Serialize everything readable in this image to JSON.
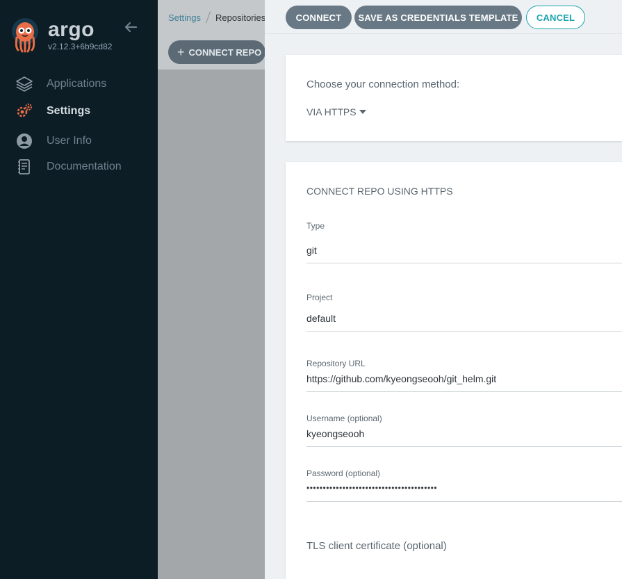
{
  "sidebar": {
    "brand": "argo",
    "version": "v2.12.3+6b9cd82",
    "items": [
      {
        "label": "Applications",
        "icon": "layers-icon",
        "active": false
      },
      {
        "label": "Settings",
        "icon": "gear-icon",
        "active": true
      },
      {
        "label": "User Info",
        "icon": "user-icon",
        "active": false
      },
      {
        "label": "Documentation",
        "icon": "book-icon",
        "active": false
      }
    ]
  },
  "background_page": {
    "breadcrumb": [
      "Settings",
      "Repositories"
    ],
    "connect_repo_label": "CONNECT REPO",
    "connect_repo_icon": "+"
  },
  "panel": {
    "buttons": {
      "connect": "CONNECT",
      "save_template": "SAVE AS CREDENTIALS TEMPLATE",
      "cancel": "CANCEL"
    },
    "method": {
      "label": "Choose your connection method:",
      "selected": "VIA HTTPS"
    },
    "form": {
      "title": "CONNECT REPO USING HTTPS",
      "type_label": "Type",
      "type_value": "git",
      "project_label": "Project",
      "project_value": "default",
      "url_label": "Repository URL",
      "url_value": "https://github.com/kyeongseooh/git_helm.git",
      "username_label": "Username (optional)",
      "username_value": "kyeongseooh",
      "password_label": "Password (optional)",
      "password_value": "••••••••••••••••••••••••••••••••••••••••",
      "tls_label": "TLS client certificate (optional)"
    }
  },
  "colors": {
    "sidebar_bg": "#0d1d26",
    "accent_teal": "#1aa3ad",
    "button_gray": "#687985",
    "argo_orange": "#e96d46"
  }
}
